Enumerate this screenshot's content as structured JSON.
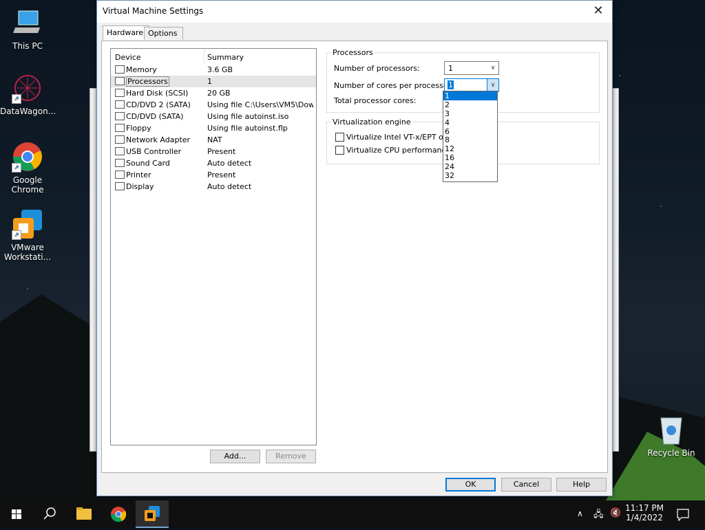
{
  "desktop": {
    "icons": [
      {
        "label": "This PC"
      },
      {
        "label": "DataWagon..."
      },
      {
        "label": "Google Chrome"
      },
      {
        "label": "VMware Workstati..."
      },
      {
        "label": "Recycle Bin"
      }
    ]
  },
  "dialog": {
    "title": "Virtual Machine Settings",
    "tabs": [
      {
        "label": "Hardware"
      },
      {
        "label": "Options"
      }
    ],
    "device_list": {
      "headers": {
        "device": "Device",
        "summary": "Summary"
      },
      "rows": [
        {
          "device": "Memory",
          "summary": "3.6 GB",
          "icon": "memory-icon"
        },
        {
          "device": "Processors",
          "summary": "1",
          "icon": "processor-icon",
          "selected": true
        },
        {
          "device": "Hard Disk (SCSI)",
          "summary": "20 GB",
          "icon": "hard-disk-icon"
        },
        {
          "device": "CD/DVD 2 (SATA)",
          "summary": "Using file C:\\Users\\VM5\\Dow...",
          "icon": "cd-icon"
        },
        {
          "device": "CD/DVD (SATA)",
          "summary": "Using file autoinst.iso",
          "icon": "cd-icon"
        },
        {
          "device": "Floppy",
          "summary": "Using file autoinst.flp",
          "icon": "floppy-icon"
        },
        {
          "device": "Network Adapter",
          "summary": "NAT",
          "icon": "network-icon"
        },
        {
          "device": "USB Controller",
          "summary": "Present",
          "icon": "usb-icon"
        },
        {
          "device": "Sound Card",
          "summary": "Auto detect",
          "icon": "sound-icon"
        },
        {
          "device": "Printer",
          "summary": "Present",
          "icon": "printer-icon"
        },
        {
          "device": "Display",
          "summary": "Auto detect",
          "icon": "display-icon"
        }
      ]
    },
    "add_button": "Add...",
    "remove_button": "Remove",
    "processors": {
      "group_label": "Processors",
      "num_processors_label": "Number of processors:",
      "num_processors_value": "1",
      "cores_label": "Number of cores per processor:",
      "cores_value": "1",
      "total_label": "Total processor cores:",
      "cores_options": [
        "1",
        "2",
        "3",
        "4",
        "6",
        "8",
        "12",
        "16",
        "24",
        "32"
      ]
    },
    "virtualization": {
      "group_label": "Virtualization engine",
      "vtx_label": "Virtualize Intel VT-x/EPT or AM",
      "perf_label": "Virtualize CPU performance co"
    },
    "ok_button": "OK",
    "cancel_button": "Cancel",
    "help_button": "Help"
  },
  "taskbar": {
    "time": "11:17 PM",
    "date": "1/4/2022"
  }
}
